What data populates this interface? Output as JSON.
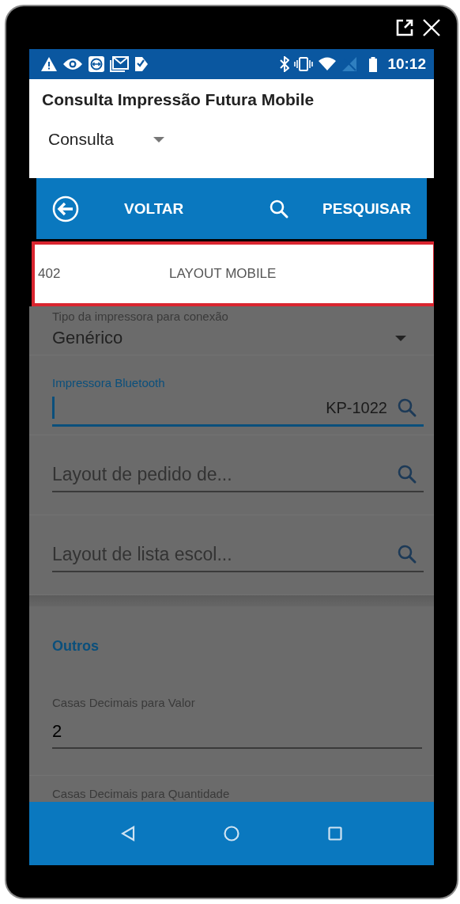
{
  "status_bar": {
    "time": "10:12"
  },
  "header": {
    "title": "Consulta Impressão Futura Mobile",
    "mode_dropdown": {
      "value": "Consulta"
    }
  },
  "toolbar": [
    {
      "kind": "back",
      "label": "VOLTAR"
    },
    {
      "kind": "search",
      "label": "PESQUISAR"
    }
  ],
  "popup_row": {
    "code": "402",
    "name": "LAYOUT MOBILE"
  },
  "fields": [
    {
      "kind": "select",
      "label": "Tipo da impressora para conexão",
      "value": "Genérico"
    },
    {
      "kind": "lookup",
      "label": "Impressora Bluetooth",
      "value": "KP-1022",
      "focused": true
    },
    {
      "kind": "lookup",
      "placeholder": "Layout de pedido de...",
      "focused": false
    },
    {
      "kind": "lookup",
      "placeholder": "Layout de lista escol...",
      "focused": false
    }
  ],
  "section": {
    "title": "Outros"
  },
  "other_fields": [
    {
      "label": "Casas Decimais para Valor",
      "value": "2"
    },
    {
      "label": "Casas Decimais para Quantidade"
    }
  ]
}
